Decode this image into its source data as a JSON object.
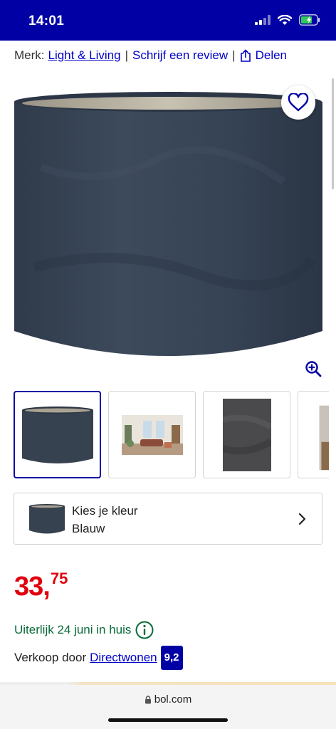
{
  "status_bar": {
    "time": "14:01"
  },
  "brand_row": {
    "merk_label": "Merk:",
    "brand_link": "Light & Living",
    "separator": "|",
    "review_link": "Schrijf een review",
    "share_label": "Delen"
  },
  "thumbnails": [
    {
      "name": "Lampenkap blauw"
    },
    {
      "name": "Interieur foto"
    },
    {
      "name": "Stof detail"
    },
    {
      "name": "Sfeerfoto"
    }
  ],
  "color_selector": {
    "label": "Kies je kleur",
    "value": "Blauw"
  },
  "price": {
    "main": "33,",
    "fraction": "75"
  },
  "delivery": {
    "text": "Uiterlijk 24 juni in huis"
  },
  "seller": {
    "prefix": "Verkoop door",
    "name": "Directwonen",
    "rating": "9,2"
  },
  "browser": {
    "url": "bol.com"
  },
  "colors": {
    "brand_blue": "#0000a4",
    "link_blue": "#0000c8",
    "price_red": "#e0000e",
    "delivery_green": "#0a6b3a"
  }
}
